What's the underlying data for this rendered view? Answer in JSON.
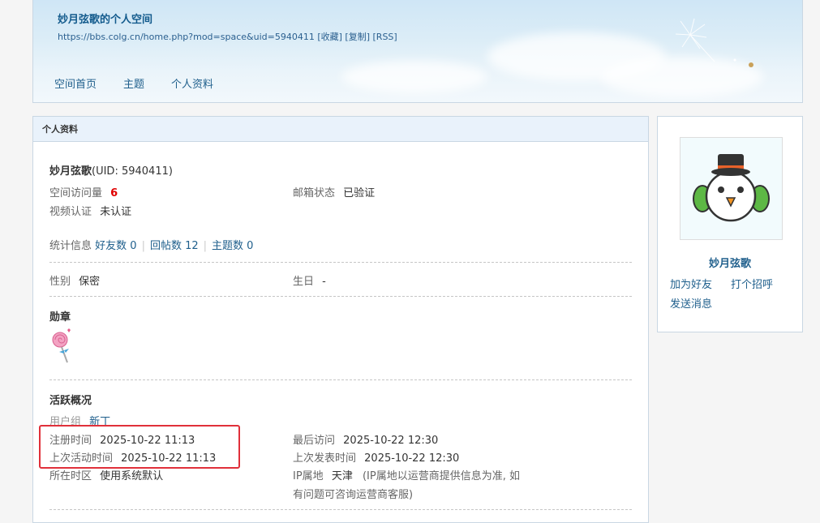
{
  "header": {
    "title": "妙月弦歌的个人空间",
    "url": "https://bbs.colg.cn/home.php?mod=space&uid=5940411",
    "favorite": "[收藏]",
    "copy": "[复制]",
    "rss": "[RSS]"
  },
  "nav": [
    "空间首页",
    "主题",
    "个人资料"
  ],
  "panel": {
    "title": "个人资料",
    "username": "妙月弦歌",
    "uid_text": "(UID: 5940411)",
    "visits_label": "空间访问量",
    "visits_value": "6",
    "email_label": "邮箱状态",
    "email_value": "已验证",
    "video_label": "视频认证",
    "video_value": "未认证",
    "stats_label": "统计信息",
    "friends": "好友数 0",
    "replies": "回帖数 12",
    "threads": "主题数 0",
    "gender_label": "性别",
    "gender_value": "保密",
    "birthday_label": "生日",
    "birthday_value": "-",
    "medals_title": "勋章",
    "activity_title": "活跃概况",
    "group_label": "用户组",
    "group_value": "新丁",
    "reg_label": "注册时间",
    "reg_value": "2025-10-22 11:13",
    "last_visit_label": "最后访问",
    "last_visit_value": "2025-10-22 12:30",
    "last_active_label": "上次活动时间",
    "last_active_value": "2025-10-22 11:13",
    "last_post_label": "上次发表时间",
    "last_post_value": "2025-10-22 12:30",
    "timezone_label": "所在时区",
    "timezone_value": "使用系统默认",
    "ip_label": "IP属地",
    "ip_value": "天津",
    "ip_note_1": "(IP属地以运营商提供信息为准, 如",
    "ip_note_2": "有问题可咨询运营商客服)"
  },
  "card": {
    "name": "妙月弦歌",
    "add_friend": "加为好友",
    "greet": "打个招呼",
    "message": "发送消息"
  },
  "colors": {
    "link": "#1f5f8c",
    "visits_highlight": "#e00000",
    "annotation_box": "#e0303a"
  }
}
